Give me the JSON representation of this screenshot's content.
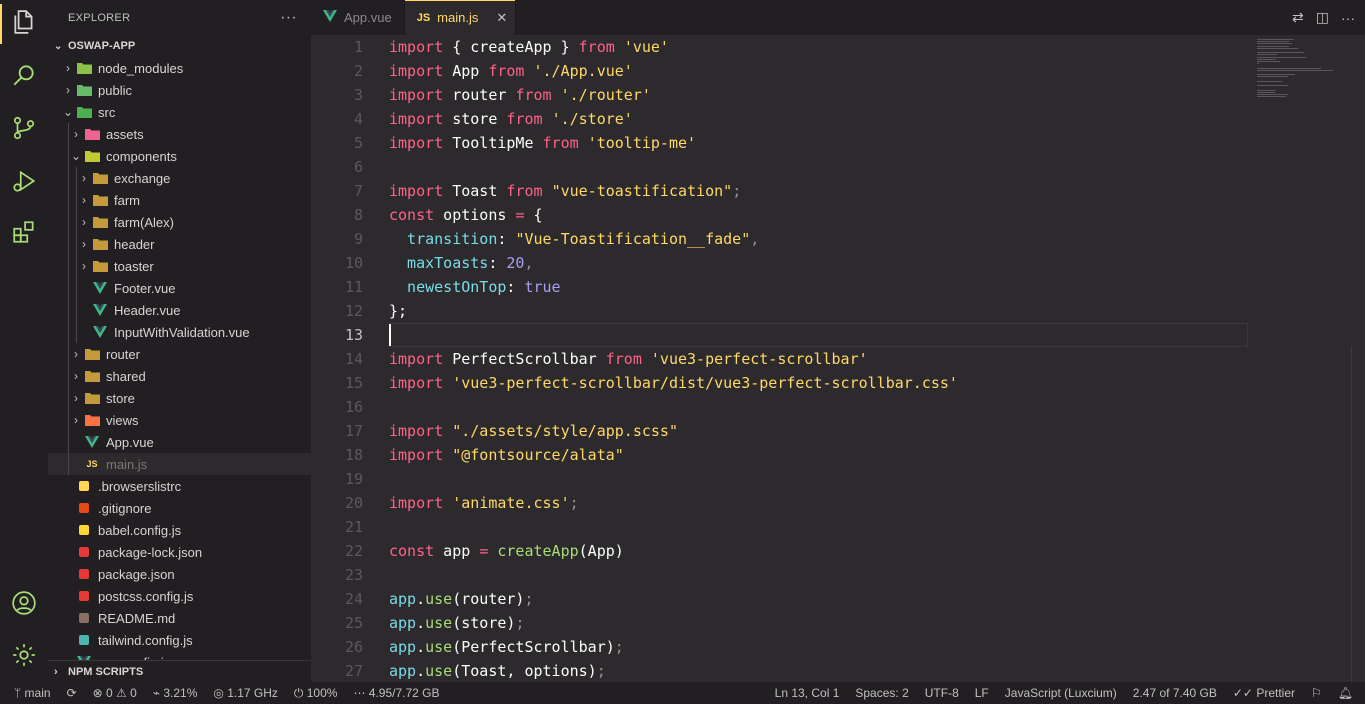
{
  "sidebar": {
    "title": "EXPLORER",
    "more": "···",
    "project": "OSWAP-APP",
    "npm": "NPM SCRIPTS",
    "items": [
      {
        "label": "node_modules",
        "depth": 1,
        "kind": "folder",
        "open": false,
        "icon": "folder-node-icon",
        "color": "#8bc34a"
      },
      {
        "label": "public",
        "depth": 1,
        "kind": "folder",
        "open": false,
        "icon": "folder-public-icon",
        "color": "#66bb6a"
      },
      {
        "label": "src",
        "depth": 1,
        "kind": "folder",
        "open": true,
        "icon": "folder-src-icon",
        "color": "#4caf50"
      },
      {
        "label": "assets",
        "depth": 2,
        "kind": "folder",
        "open": false,
        "icon": "folder-assets-icon",
        "color": "#f06292"
      },
      {
        "label": "components",
        "depth": 2,
        "kind": "folder",
        "open": true,
        "icon": "folder-components-icon",
        "color": "#c0ca33"
      },
      {
        "label": "exchange",
        "depth": 3,
        "kind": "folder",
        "open": false,
        "icon": "folder-icon",
        "color": "#c49a3a"
      },
      {
        "label": "farm",
        "depth": 3,
        "kind": "folder",
        "open": false,
        "icon": "folder-icon",
        "color": "#c49a3a"
      },
      {
        "label": "farm(Alex)",
        "depth": 3,
        "kind": "folder",
        "open": false,
        "icon": "folder-icon",
        "color": "#c49a3a"
      },
      {
        "label": "header",
        "depth": 3,
        "kind": "folder",
        "open": false,
        "icon": "folder-icon",
        "color": "#c49a3a"
      },
      {
        "label": "toaster",
        "depth": 3,
        "kind": "folder",
        "open": false,
        "icon": "folder-icon",
        "color": "#c49a3a"
      },
      {
        "label": "Footer.vue",
        "depth": 3,
        "kind": "file",
        "icon": "vue-icon",
        "color": "#41b883"
      },
      {
        "label": "Header.vue",
        "depth": 3,
        "kind": "file",
        "icon": "vue-icon",
        "color": "#41b883"
      },
      {
        "label": "InputWithValidation.vue",
        "depth": 3,
        "kind": "file",
        "icon": "vue-icon",
        "color": "#41b883"
      },
      {
        "label": "router",
        "depth": 2,
        "kind": "folder",
        "open": false,
        "icon": "folder-icon",
        "color": "#c49a3a"
      },
      {
        "label": "shared",
        "depth": 2,
        "kind": "folder",
        "open": false,
        "icon": "folder-icon",
        "color": "#c49a3a"
      },
      {
        "label": "store",
        "depth": 2,
        "kind": "folder",
        "open": false,
        "icon": "folder-icon",
        "color": "#c49a3a"
      },
      {
        "label": "views",
        "depth": 2,
        "kind": "folder",
        "open": false,
        "icon": "folder-views-icon",
        "color": "#ff7043"
      },
      {
        "label": "App.vue",
        "depth": 2,
        "kind": "file",
        "icon": "vue-icon",
        "color": "#41b883"
      },
      {
        "label": "main.js",
        "depth": 2,
        "kind": "file",
        "icon": "js-icon",
        "color": "#ffd866",
        "selected": true
      },
      {
        "label": ".browserslistrc",
        "depth": 1,
        "kind": "file",
        "icon": "browserslist-icon",
        "color": "#ffd54f"
      },
      {
        "label": ".gitignore",
        "depth": 1,
        "kind": "file",
        "icon": "git-icon",
        "color": "#e64a19"
      },
      {
        "label": "babel.config.js",
        "depth": 1,
        "kind": "file",
        "icon": "babel-icon",
        "color": "#fdd835"
      },
      {
        "label": "package-lock.json",
        "depth": 1,
        "kind": "file",
        "icon": "npm-icon",
        "color": "#e53935"
      },
      {
        "label": "package.json",
        "depth": 1,
        "kind": "file",
        "icon": "npm-icon",
        "color": "#e53935"
      },
      {
        "label": "postcss.config.js",
        "depth": 1,
        "kind": "file",
        "icon": "postcss-icon",
        "color": "#e53935"
      },
      {
        "label": "README.md",
        "depth": 1,
        "kind": "file",
        "icon": "readme-icon",
        "color": "#8d6e63"
      },
      {
        "label": "tailwind.config.js",
        "depth": 1,
        "kind": "file",
        "icon": "tailwind-icon",
        "color": "#4db6ac"
      },
      {
        "label": "vue.config.js",
        "depth": 1,
        "kind": "file",
        "icon": "vue-icon",
        "color": "#41b883"
      }
    ]
  },
  "tabs": [
    {
      "label": "App.vue",
      "icon": "vue-icon",
      "active": false
    },
    {
      "label": "main.js",
      "icon": "js-icon",
      "active": true,
      "close": "✕"
    }
  ],
  "editor": {
    "current_line": 13,
    "lines": [
      [
        [
          "import",
          "kw"
        ],
        [
          " { ",
          ""
        ],
        [
          "createApp",
          ""
        ],
        [
          " } ",
          ""
        ],
        [
          "from",
          "kw"
        ],
        [
          " ",
          ""
        ],
        [
          "'vue'",
          "st"
        ]
      ],
      [
        [
          "import",
          "kw"
        ],
        [
          " App ",
          ""
        ],
        [
          "from",
          "kw"
        ],
        [
          " ",
          ""
        ],
        [
          "'./App.vue'",
          "st"
        ]
      ],
      [
        [
          "import",
          "kw"
        ],
        [
          " router ",
          ""
        ],
        [
          "from",
          "kw"
        ],
        [
          " ",
          ""
        ],
        [
          "'./router'",
          "st"
        ]
      ],
      [
        [
          "import",
          "kw"
        ],
        [
          " store ",
          ""
        ],
        [
          "from",
          "kw"
        ],
        [
          " ",
          ""
        ],
        [
          "'./store'",
          "st"
        ]
      ],
      [
        [
          "import",
          "kw"
        ],
        [
          " TooltipMe ",
          ""
        ],
        [
          "from",
          "kw"
        ],
        [
          " ",
          ""
        ],
        [
          "'tooltip-me'",
          "st"
        ]
      ],
      [],
      [
        [
          "import",
          "kw"
        ],
        [
          " Toast ",
          ""
        ],
        [
          "from",
          "kw"
        ],
        [
          " ",
          ""
        ],
        [
          "\"vue-toastification\"",
          "st"
        ],
        [
          ";",
          "pu"
        ]
      ],
      [
        [
          "const",
          "kw"
        ],
        [
          " options ",
          ""
        ],
        [
          "=",
          "op"
        ],
        [
          " {",
          ""
        ]
      ],
      [
        [
          "  transition",
          "pr"
        ],
        [
          ": ",
          ""
        ],
        [
          "\"Vue-Toastification__fade\"",
          "st"
        ],
        [
          ",",
          "pu"
        ]
      ],
      [
        [
          "  maxToasts",
          "pr"
        ],
        [
          ": ",
          ""
        ],
        [
          "20",
          "nm"
        ],
        [
          ",",
          "pu"
        ]
      ],
      [
        [
          "  newestOnTop",
          "pr"
        ],
        [
          ": ",
          ""
        ],
        [
          "true",
          "nm"
        ]
      ],
      [
        [
          "};",
          ""
        ]
      ],
      [],
      [
        [
          "import",
          "kw"
        ],
        [
          " PerfectScrollbar ",
          ""
        ],
        [
          "from",
          "kw"
        ],
        [
          " ",
          ""
        ],
        [
          "'vue3-perfect-scrollbar'",
          "st"
        ]
      ],
      [
        [
          "import",
          "kw"
        ],
        [
          " ",
          ""
        ],
        [
          "'vue3-perfect-scrollbar/dist/vue3-perfect-scrollbar.css'",
          "st"
        ]
      ],
      [],
      [
        [
          "import",
          "kw"
        ],
        [
          " ",
          ""
        ],
        [
          "\"./assets/style/app.scss\"",
          "st"
        ]
      ],
      [
        [
          "import",
          "kw"
        ],
        [
          " ",
          ""
        ],
        [
          "\"@fontsource/alata\"",
          "st"
        ]
      ],
      [],
      [
        [
          "import",
          "kw"
        ],
        [
          " ",
          ""
        ],
        [
          "'animate.css'",
          "st"
        ],
        [
          ";",
          "pu"
        ]
      ],
      [],
      [
        [
          "const",
          "kw"
        ],
        [
          " app ",
          ""
        ],
        [
          "=",
          "op"
        ],
        [
          " ",
          ""
        ],
        [
          "createApp",
          "fn"
        ],
        [
          "(App)",
          ""
        ]
      ],
      [],
      [
        [
          "app",
          "pr"
        ],
        [
          ".",
          ""
        ],
        [
          "use",
          "fn"
        ],
        [
          "(router)",
          ""
        ],
        [
          ";",
          "pu"
        ]
      ],
      [
        [
          "app",
          "pr"
        ],
        [
          ".",
          ""
        ],
        [
          "use",
          "fn"
        ],
        [
          "(store)",
          ""
        ],
        [
          ";",
          "pu"
        ]
      ],
      [
        [
          "app",
          "pr"
        ],
        [
          ".",
          ""
        ],
        [
          "use",
          "fn"
        ],
        [
          "(PerfectScrollbar)",
          ""
        ],
        [
          ";",
          "pu"
        ]
      ],
      [
        [
          "app",
          "pr"
        ],
        [
          ".",
          ""
        ],
        [
          "use",
          "fn"
        ],
        [
          "(Toast, options)",
          ""
        ],
        [
          ";",
          "pu"
        ]
      ]
    ]
  },
  "status": {
    "branch": "main",
    "sync": "⟳",
    "problems": "⊗ 0 ⚠ 0",
    "cpu": "3.21%",
    "freq": "1.17 GHz",
    "battery": "100%",
    "memory": "4.95/7.72 GB",
    "position": "Ln 13, Col 1",
    "spaces": "Spaces: 2",
    "encoding": "UTF-8",
    "eol": "LF",
    "language": "JavaScript (Luxcium)",
    "storage": "2.47 of 7.40 GB",
    "prettier": "Prettier"
  }
}
